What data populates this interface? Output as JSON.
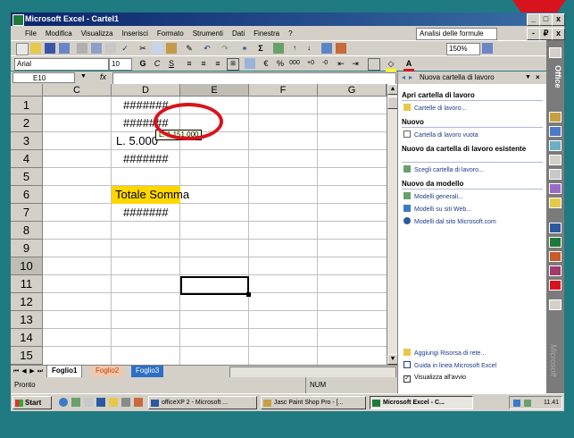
{
  "window": {
    "title": "Microsoft Excel - Cartel1",
    "buttons": [
      "_",
      "□",
      "x"
    ]
  },
  "menubar": {
    "items": [
      "File",
      "Modifica",
      "Visualizza",
      "Inserisci",
      "Formato",
      "Strumenti",
      "Dati",
      "Finestra",
      "?"
    ],
    "help_box": "Analisi delle formule",
    "doc_buttons": [
      "-",
      "₽",
      "x"
    ]
  },
  "toolbar": {
    "font": "Arial",
    "size": "10",
    "zoom": "150%",
    "format_buttons": [
      "G",
      "C",
      "S"
    ]
  },
  "formula_bar": {
    "cell_ref": "E10",
    "fx": "fx",
    "value": ""
  },
  "sheet": {
    "columns": [
      "C",
      "D",
      "E",
      "F",
      "G"
    ],
    "rows": [
      "1",
      "2",
      "3",
      "4",
      "5",
      "6",
      "7",
      "8",
      "9",
      "10",
      "11",
      "12",
      "13",
      "14",
      "15"
    ],
    "cells": {
      "D1": "#######",
      "D2": "#######",
      "D3": "L.  5.000",
      "D4": "#######",
      "D6": "Totale Somma",
      "D7": "#######"
    },
    "tooltip": "L. 1.151.000",
    "selected_cell": "E10",
    "highlight_color": "#ffd700",
    "annotation_color": "#d7141d"
  },
  "sheet_tabs": {
    "tabs": [
      "Foglio1",
      "Foglio2",
      "Foglio3"
    ],
    "active": "Foglio1"
  },
  "statusbar": {
    "left": "Pronto",
    "right": "NUM"
  },
  "task_pane": {
    "title": "Nuova cartella di lavoro",
    "sections": [
      {
        "heading": "Apri cartella di lavoro",
        "links": [
          "Cartelle di lavoro..."
        ]
      },
      {
        "heading": "Nuovo",
        "links": [
          "Cartella di lavoro vuota"
        ]
      },
      {
        "heading": "Nuovo da cartella di lavoro esistente",
        "links": [
          "Scegli cartella di lavoro..."
        ]
      },
      {
        "heading": "Nuovo da modello",
        "links": [
          "Modelli generali...",
          "Modelli su siti Web...",
          "Modelli dal sito Microsoft.com"
        ]
      }
    ],
    "footer_links": [
      "Aggiungi Risorsa di rete...",
      "Guida in linea Microsoft Excel"
    ],
    "startup_checkbox": "Visualizza all'avvio"
  },
  "office_bar": {
    "label": "Office",
    "brand": "Microsoft"
  },
  "taskbar": {
    "start": "Start",
    "tasks": [
      "officeXP 2 - Microsoft ...",
      "Jasc Paint Shop Pro - [...",
      "Microsoft Excel - C..."
    ],
    "clock": "11.41"
  }
}
